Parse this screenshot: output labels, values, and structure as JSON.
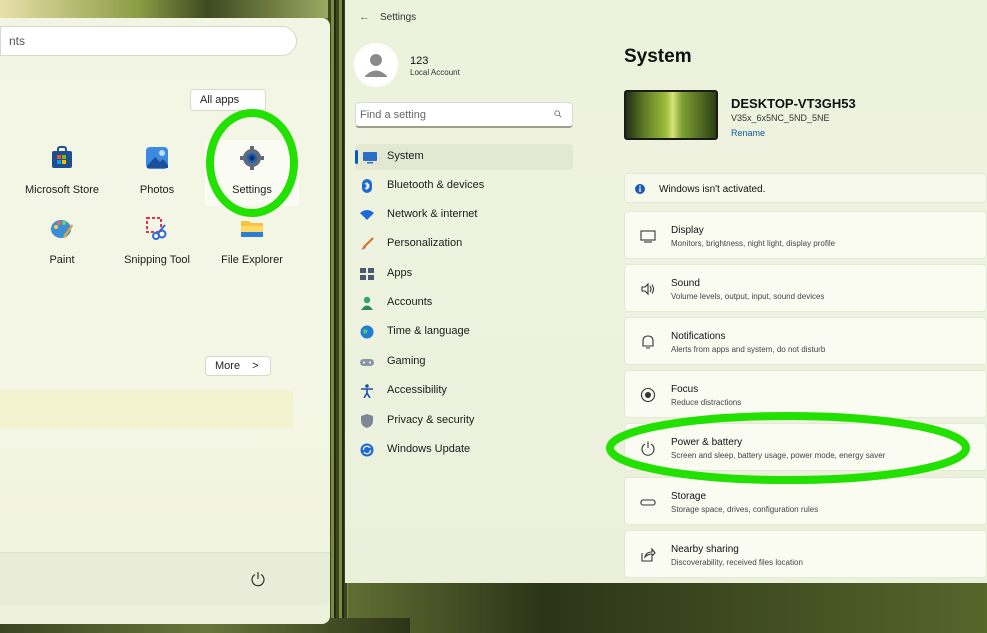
{
  "start_menu": {
    "search_text": "nts",
    "all_apps_label": "All apps",
    "more_label": "More",
    "pinned_apps": [
      {
        "label": "Microsoft Store",
        "icon": "microsoft-store-icon"
      },
      {
        "label": "Photos",
        "icon": "photos-icon"
      },
      {
        "label": "Settings",
        "icon": "settings-gear-icon"
      },
      {
        "label": "Paint",
        "icon": "paint-icon"
      },
      {
        "label": "Snipping Tool",
        "icon": "snipping-tool-icon"
      },
      {
        "label": "File Explorer",
        "icon": "file-explorer-icon"
      }
    ]
  },
  "settings": {
    "window_title": "Settings",
    "user": {
      "name": "123",
      "type": "Local Account"
    },
    "search_placeholder": "Find a setting",
    "nav": [
      {
        "label": "System",
        "icon": "system-icon",
        "active": true
      },
      {
        "label": "Bluetooth & devices",
        "icon": "bluetooth-icon"
      },
      {
        "label": "Network & internet",
        "icon": "wifi-icon"
      },
      {
        "label": "Personalization",
        "icon": "brush-icon"
      },
      {
        "label": "Apps",
        "icon": "apps-icon"
      },
      {
        "label": "Accounts",
        "icon": "accounts-icon"
      },
      {
        "label": "Time & language",
        "icon": "globe-clock-icon"
      },
      {
        "label": "Gaming",
        "icon": "gamepad-icon"
      },
      {
        "label": "Accessibility",
        "icon": "accessibility-icon"
      },
      {
        "label": "Privacy & security",
        "icon": "shield-icon"
      },
      {
        "label": "Windows Update",
        "icon": "windows-update-icon"
      }
    ],
    "page_title": "System",
    "device": {
      "name": "DESKTOP-VT3GH53",
      "model": "V35x_6x5NC_5ND_5NE",
      "rename": "Rename"
    },
    "activation_text": "Windows isn't activated.",
    "cards": [
      {
        "title": "Display",
        "subtitle": "Monitors, brightness, night light, display profile",
        "icon": "display-icon"
      },
      {
        "title": "Sound",
        "subtitle": "Volume levels, output, input, sound devices",
        "icon": "speaker-icon"
      },
      {
        "title": "Notifications",
        "subtitle": "Alerts from apps and system, do not disturb",
        "icon": "bell-icon"
      },
      {
        "title": "Focus",
        "subtitle": "Reduce distractions",
        "icon": "focus-icon"
      },
      {
        "title": "Power & battery",
        "subtitle": "Screen and sleep, battery usage, power mode, energy saver",
        "icon": "power-icon"
      },
      {
        "title": "Storage",
        "subtitle": "Storage space, drives, configuration rules",
        "icon": "storage-icon"
      },
      {
        "title": "Nearby sharing",
        "subtitle": "Discoverability, received files location",
        "icon": "share-icon"
      }
    ]
  },
  "colors": {
    "highlight": "#22e000",
    "accent": "#005fb8"
  }
}
